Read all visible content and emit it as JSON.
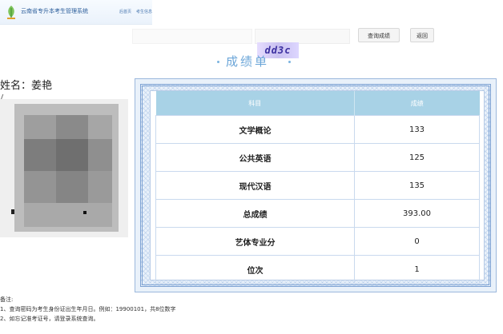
{
  "header": {
    "system_title": "云南省专升本考生管理系统",
    "nav": [
      "后首页",
      "考生信息"
    ]
  },
  "search": {
    "query_button": "查询成绩",
    "back_button": "返回"
  },
  "captcha": {
    "text": "dd3c"
  },
  "sheet": {
    "title": "成绩单",
    "name_label": "姓名：",
    "name_value": "姜艳"
  },
  "table": {
    "headers": [
      "科目",
      "成绩"
    ],
    "rows": [
      {
        "subject": "文学概论",
        "score": "133"
      },
      {
        "subject": "公共英语",
        "score": "125"
      },
      {
        "subject": "现代汉语",
        "score": "135"
      },
      {
        "subject": "总成绩",
        "score": "393.00"
      },
      {
        "subject": "艺体专业分",
        "score": "0"
      },
      {
        "subject": "位次",
        "score": "1"
      }
    ]
  },
  "notes": {
    "heading": "备注:",
    "lines": [
      "1、查询密码为考生身份证出生年月日。例如：19900101，共8位数字",
      "2、如忘记准考证号，请登录系统查询。"
    ]
  },
  "colors": {
    "accent": "#a8d2e6",
    "frame": "#7da2d3",
    "captcha_bg": "#d6cdf8"
  }
}
